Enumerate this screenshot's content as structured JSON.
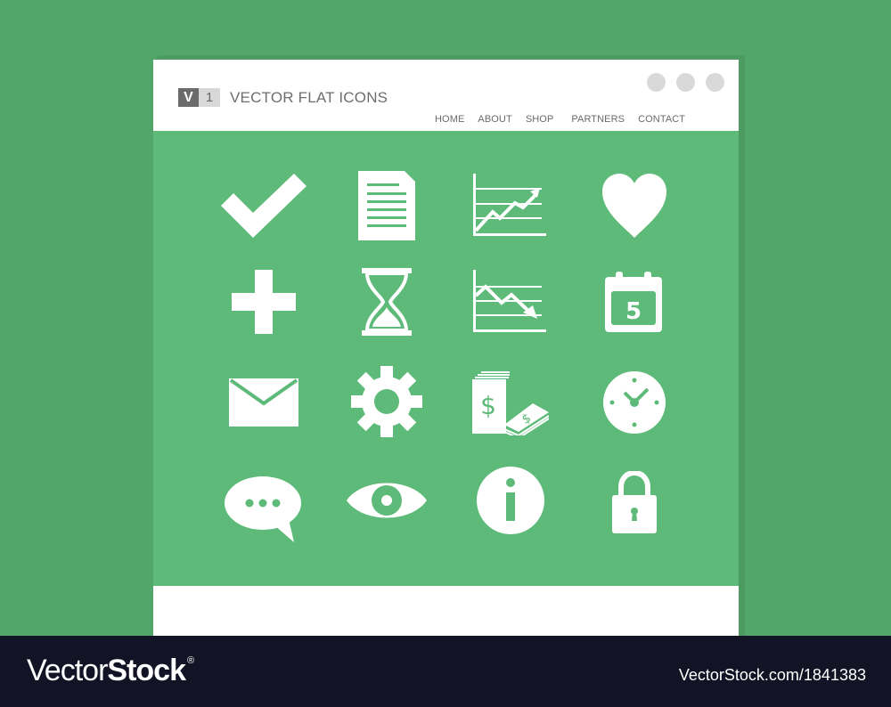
{
  "header": {
    "logo_letter": "V",
    "logo_number": "1",
    "title": "VECTOR FLAT ICONS",
    "window_controls": [
      "circle",
      "circle",
      "circle"
    ],
    "nav": [
      "HOME",
      "ABOUT",
      "SHOP",
      "PARTNERS",
      "CONTACT"
    ]
  },
  "icons": [
    {
      "name": "checkmark-icon"
    },
    {
      "name": "document-icon"
    },
    {
      "name": "chart-up-icon"
    },
    {
      "name": "heart-icon"
    },
    {
      "name": "plus-icon"
    },
    {
      "name": "hourglass-icon"
    },
    {
      "name": "chart-down-icon"
    },
    {
      "name": "calendar-icon",
      "label": "5"
    },
    {
      "name": "mail-icon"
    },
    {
      "name": "gear-icon"
    },
    {
      "name": "money-icon",
      "label": "$"
    },
    {
      "name": "clock-icon"
    },
    {
      "name": "chat-bubble-icon"
    },
    {
      "name": "eye-icon"
    },
    {
      "name": "info-icon",
      "label": "i"
    },
    {
      "name": "lock-icon"
    }
  ],
  "watermark": {
    "brand_light": "Vector",
    "brand_bold": "Stock",
    "registered": "®",
    "image_id": "VectorStock.com/1841383"
  },
  "colors": {
    "background": "#53a66a",
    "content": "#5eba78",
    "icon": "#ffffff",
    "watermark_bar": "#121324"
  }
}
